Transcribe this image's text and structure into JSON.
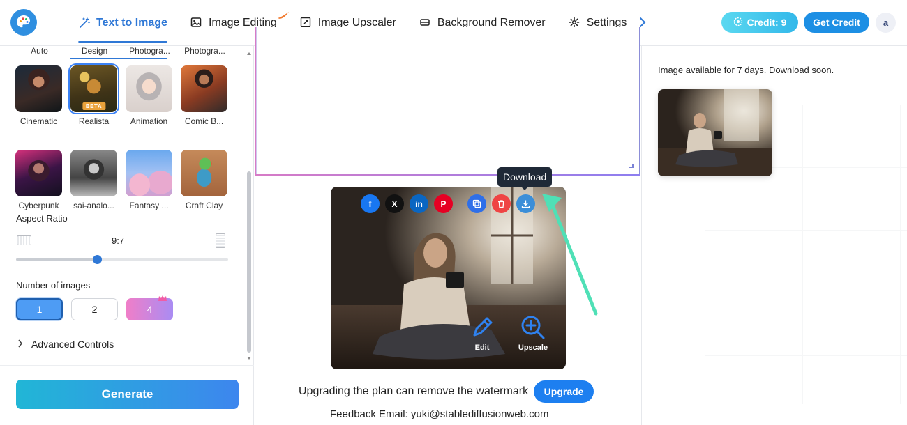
{
  "header": {
    "nav": [
      {
        "label": "Text to Image",
        "icon": "magic-wand-icon",
        "active": true
      },
      {
        "label": "Image Editing",
        "icon": "image-icon",
        "active": false
      },
      {
        "label": "Image Upscaler",
        "icon": "expand-icon",
        "active": false
      },
      {
        "label": "Background Remover",
        "icon": "eraser-icon",
        "active": false
      },
      {
        "label": "Settings",
        "icon": "gear-icon",
        "active": false
      }
    ],
    "credit_label": "Credit: 9",
    "get_credit_label": "Get Credit",
    "avatar_initial": "a"
  },
  "left": {
    "style_tabs": [
      "Auto",
      "Design",
      "Photogra...",
      "Photogra..."
    ],
    "styles": [
      {
        "name": "Cinematic",
        "selected": false,
        "badge": ""
      },
      {
        "name": "Realista",
        "selected": true,
        "badge": "BETA"
      },
      {
        "name": "Animation",
        "selected": false,
        "badge": ""
      },
      {
        "name": "Comic B...",
        "selected": false,
        "badge": ""
      },
      {
        "name": "Cyberpunk",
        "selected": false,
        "badge": ""
      },
      {
        "name": "sai-analo...",
        "selected": false,
        "badge": ""
      },
      {
        "name": "Fantasy ...",
        "selected": false,
        "badge": ""
      },
      {
        "name": "Craft Clay",
        "selected": false,
        "badge": ""
      }
    ],
    "aspect_ratio_title": "Aspect Ratio",
    "aspect_ratio_value": "9:7",
    "aspect_slider_fraction": 0.38,
    "num_images_title": "Number of images",
    "num_images_options": [
      "1",
      "2",
      "4"
    ],
    "num_images_selected": "1",
    "advanced_controls_label": "Advanced Controls",
    "generate_label": "Generate"
  },
  "result": {
    "tooltip": "Download",
    "edit_label": "Edit",
    "upscale_label": "Upscale",
    "upgrade_text": "Upgrading the plan can remove the watermark",
    "upgrade_label": "Upgrade",
    "feedback": "Feedback Email: yuki@stablediffusionweb.com"
  },
  "right": {
    "availability": "Image available for 7 days. Download soon."
  },
  "colors": {
    "accent": "#2f78d6",
    "generate_start": "#21b6d6",
    "generate_end": "#3d86ee",
    "annotation_arrow": "#4fe0b6"
  }
}
